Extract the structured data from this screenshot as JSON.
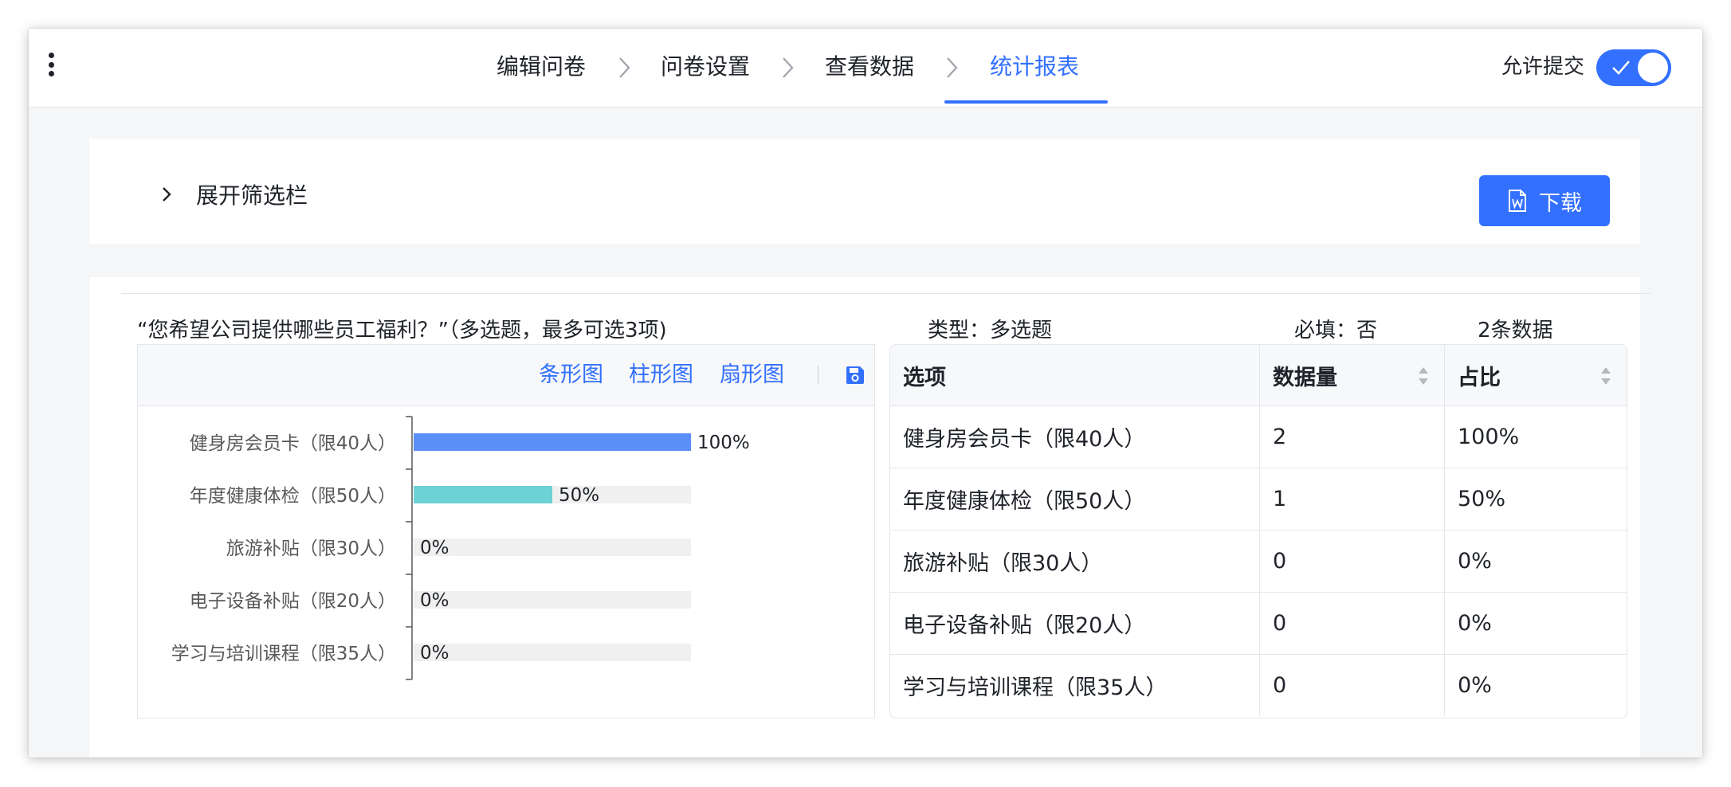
{
  "nav": {
    "steps": [
      "编辑问卷",
      "问卷设置",
      "查看数据",
      "统计报表"
    ],
    "active_step": 3,
    "allow_submit_label": "允许提交",
    "allow_submit_on": true
  },
  "filter": {
    "expand_label": "展开筛选栏",
    "download_label": "下载"
  },
  "question": {
    "title": "“您希望公司提供哪些员工福利？”（多选题，最多可选3项)",
    "type_label": "类型：多选题",
    "required_label": "必填：否",
    "count_label": "2条数据"
  },
  "chart_toolbar": {
    "bar_h": "条形图",
    "bar_v": "柱形图",
    "pie": "扇形图"
  },
  "colors": {
    "accent": "#3370ff",
    "bar1": "#5b8ff9",
    "bar2": "#6dd1d5",
    "track": "#f0f0f0"
  },
  "chart_data": {
    "type": "bar",
    "orientation": "horizontal",
    "categories": [
      "健身房会员卡（限40人）",
      "年度健康体检（限50人）",
      "旅游补贴（限30人）",
      "电子设备补贴（限20人）",
      "学习与培训课程（限35人）"
    ],
    "values": [
      100,
      50,
      0,
      0,
      0
    ],
    "value_labels": [
      "100%",
      "50%",
      "0%",
      "0%",
      "0%"
    ],
    "xlim": [
      0,
      100
    ],
    "grid": false
  },
  "table": {
    "headers": [
      "选项",
      "数据量",
      "占比"
    ],
    "rows": [
      [
        "健身房会员卡（限40人）",
        "2",
        "100%"
      ],
      [
        "年度健康体检（限50人）",
        "1",
        "50%"
      ],
      [
        "旅游补贴（限30人）",
        "0",
        "0%"
      ],
      [
        "电子设备补贴（限20人）",
        "0",
        "0%"
      ],
      [
        "学习与培训课程（限35人）",
        "0",
        "0%"
      ]
    ]
  }
}
